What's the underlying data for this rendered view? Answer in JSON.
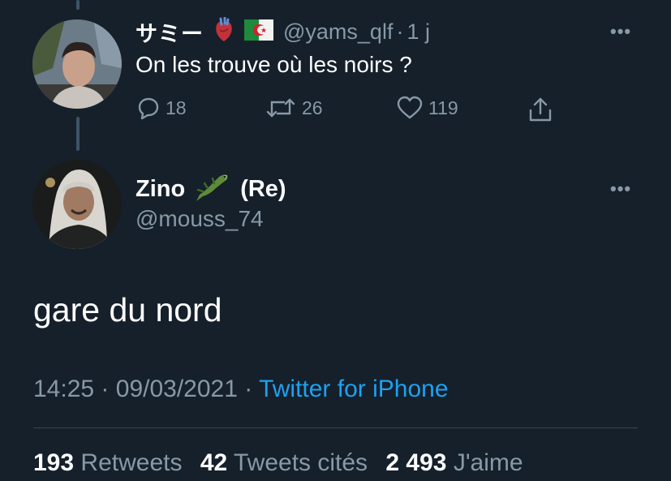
{
  "parent_tweet": {
    "display_name": "サミー",
    "emoji_icons": [
      "anatomical-heart-icon",
      "algeria-flag-icon"
    ],
    "handle": "@yams_qlf",
    "separator": "·",
    "time_ago": "1 j",
    "text": "On les trouve où les noirs ?",
    "actions": {
      "replies": "18",
      "retweets": "26",
      "likes": "119"
    }
  },
  "main_tweet": {
    "display_name_part1": "Zino",
    "emoji_icon": "crocodile-icon",
    "display_name_part2": "(Re)",
    "handle": "@mouss_74",
    "text": "gare du nord",
    "time": "14:25",
    "separator1": "·",
    "date": "09/03/2021",
    "separator2": "·",
    "source": "Twitter for iPhone",
    "stats": {
      "retweets_count": "193",
      "retweets_label": "Retweets",
      "quotes_count": "42",
      "quotes_label": "Tweets cités",
      "likes_count": "2 493",
      "likes_label": "J'aime"
    }
  },
  "more_glyph": "•••",
  "colors": {
    "background": "#15202b",
    "primary_text": "#ffffff",
    "secondary_text": "#8899a6",
    "link": "#1da1f2",
    "divider": "#38444d"
  }
}
